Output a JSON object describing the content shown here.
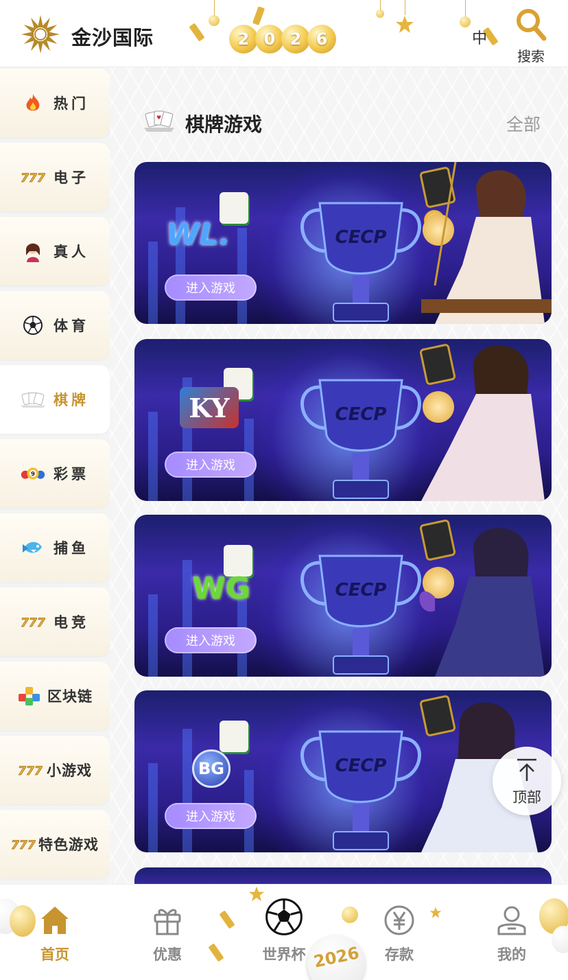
{
  "header": {
    "brand": "金沙国际",
    "year_deco": [
      "2",
      "0",
      "2",
      "6"
    ],
    "lang": "中",
    "search_label": "搜索"
  },
  "sidebar": {
    "items": [
      {
        "label": "热门",
        "icon": "fire-icon",
        "active": false
      },
      {
        "label": "电子",
        "icon": "slot-777-icon",
        "active": false
      },
      {
        "label": "真人",
        "icon": "live-dealer-icon",
        "active": false
      },
      {
        "label": "体育",
        "icon": "soccer-ball-icon",
        "active": false
      },
      {
        "label": "棋牌",
        "icon": "playing-cards-icon",
        "active": true
      },
      {
        "label": "彩票",
        "icon": "lottery-balls-icon",
        "active": false
      },
      {
        "label": "捕鱼",
        "icon": "fish-icon",
        "active": false
      },
      {
        "label": "电竞",
        "icon": "slot-777-icon",
        "active": false
      },
      {
        "label": "区块链",
        "icon": "blockchain-cubes-icon",
        "active": false
      },
      {
        "label": "小游戏",
        "icon": "slot-777-icon",
        "active": false
      },
      {
        "label": "特色游戏",
        "icon": "slot-777-icon",
        "active": false
      }
    ]
  },
  "section": {
    "title": "棋牌游戏",
    "all_label": "全部"
  },
  "cards": [
    {
      "provider": "WL.",
      "enter_label": "进入游戏",
      "brand_text": "CECP"
    },
    {
      "provider": "KY",
      "enter_label": "进入游戏",
      "brand_text": "CECP"
    },
    {
      "provider": "WG",
      "enter_label": "进入游戏",
      "brand_text": "CECP"
    },
    {
      "provider": "BG",
      "enter_label": "进入游戏",
      "brand_text": "CECP"
    }
  ],
  "back_to_top": {
    "label": "顶部"
  },
  "bottom_nav": {
    "items": [
      {
        "label": "首页",
        "icon": "home-icon",
        "active": true
      },
      {
        "label": "优惠",
        "icon": "gift-icon",
        "active": false
      },
      {
        "label": "世界杯",
        "icon": "soccer-ball-icon",
        "active": false
      },
      {
        "label": "存款",
        "icon": "yen-coin-icon",
        "active": false
      },
      {
        "label": "我的",
        "icon": "user-icon",
        "active": false
      }
    ],
    "badge_text": "2026"
  },
  "colors": {
    "accent_gold": "#c7942f",
    "inactive_gray": "#888888",
    "card_purple": "#3a2aa8",
    "enter_button": "#b59cff"
  }
}
